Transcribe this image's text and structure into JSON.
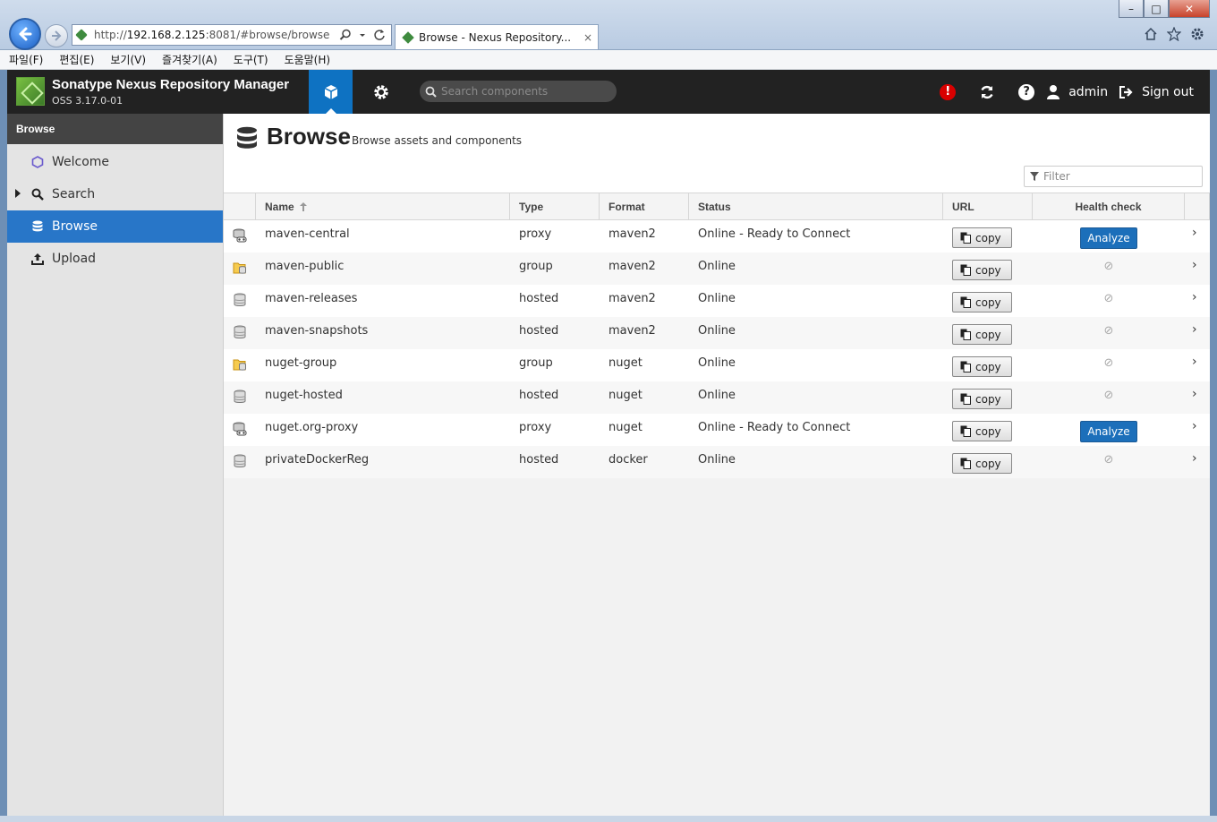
{
  "browser": {
    "url_prefix": "http://",
    "url_host": "192.168.2.125",
    "url_rest": ":8081/#browse/browse",
    "tab_title": "Browse - Nexus Repository...",
    "tab_close": "×",
    "win_min": "–",
    "win_max": "□",
    "win_close": "✕"
  },
  "menubar": [
    "파일(F)",
    "편집(E)",
    "보기(V)",
    "즐겨찾기(A)",
    "도구(T)",
    "도움말(H)"
  ],
  "header": {
    "product_name": "Sonatype Nexus Repository Manager",
    "version": "OSS 3.17.0-01",
    "search_placeholder": "Search components",
    "user": "admin",
    "signout": "Sign out",
    "alert_glyph": "!",
    "help_glyph": "?"
  },
  "sidebar": {
    "title": "Browse",
    "items": [
      {
        "label": "Welcome",
        "icon": "hexagon-icon",
        "active": false
      },
      {
        "label": "Search",
        "icon": "search-icon",
        "active": false
      },
      {
        "label": "Browse",
        "icon": "database-icon",
        "active": true
      },
      {
        "label": "Upload",
        "icon": "upload-icon",
        "active": false
      }
    ]
  },
  "page": {
    "title": "Browse",
    "subtitle": "Browse assets and components",
    "filter_placeholder": "Filter"
  },
  "table": {
    "columns": {
      "name": "Name",
      "type": "Type",
      "format": "Format",
      "status": "Status",
      "url": "URL",
      "health": "Health check"
    },
    "copy_label": "copy",
    "analyze_label": "Analyze",
    "na_glyph": "⊘",
    "chevron": "›",
    "rows": [
      {
        "name": "maven-central",
        "type": "proxy",
        "format": "maven2",
        "status": "Online - Ready to Connect",
        "health": "analyze"
      },
      {
        "name": "maven-public",
        "type": "group",
        "format": "maven2",
        "status": "Online",
        "health": "na"
      },
      {
        "name": "maven-releases",
        "type": "hosted",
        "format": "maven2",
        "status": "Online",
        "health": "na"
      },
      {
        "name": "maven-snapshots",
        "type": "hosted",
        "format": "maven2",
        "status": "Online",
        "health": "na"
      },
      {
        "name": "nuget-group",
        "type": "group",
        "format": "nuget",
        "status": "Online",
        "health": "na"
      },
      {
        "name": "nuget-hosted",
        "type": "hosted",
        "format": "nuget",
        "status": "Online",
        "health": "na"
      },
      {
        "name": "nuget.org-proxy",
        "type": "proxy",
        "format": "nuget",
        "status": "Online - Ready to Connect",
        "health": "analyze"
      },
      {
        "name": "privateDockerReg",
        "type": "hosted",
        "format": "docker",
        "status": "Online",
        "health": "na"
      }
    ]
  },
  "colors": {
    "header_bg": "#222222",
    "accent": "#0e72c2",
    "sidebar_active": "#2876c8",
    "alert": "#d90000"
  }
}
